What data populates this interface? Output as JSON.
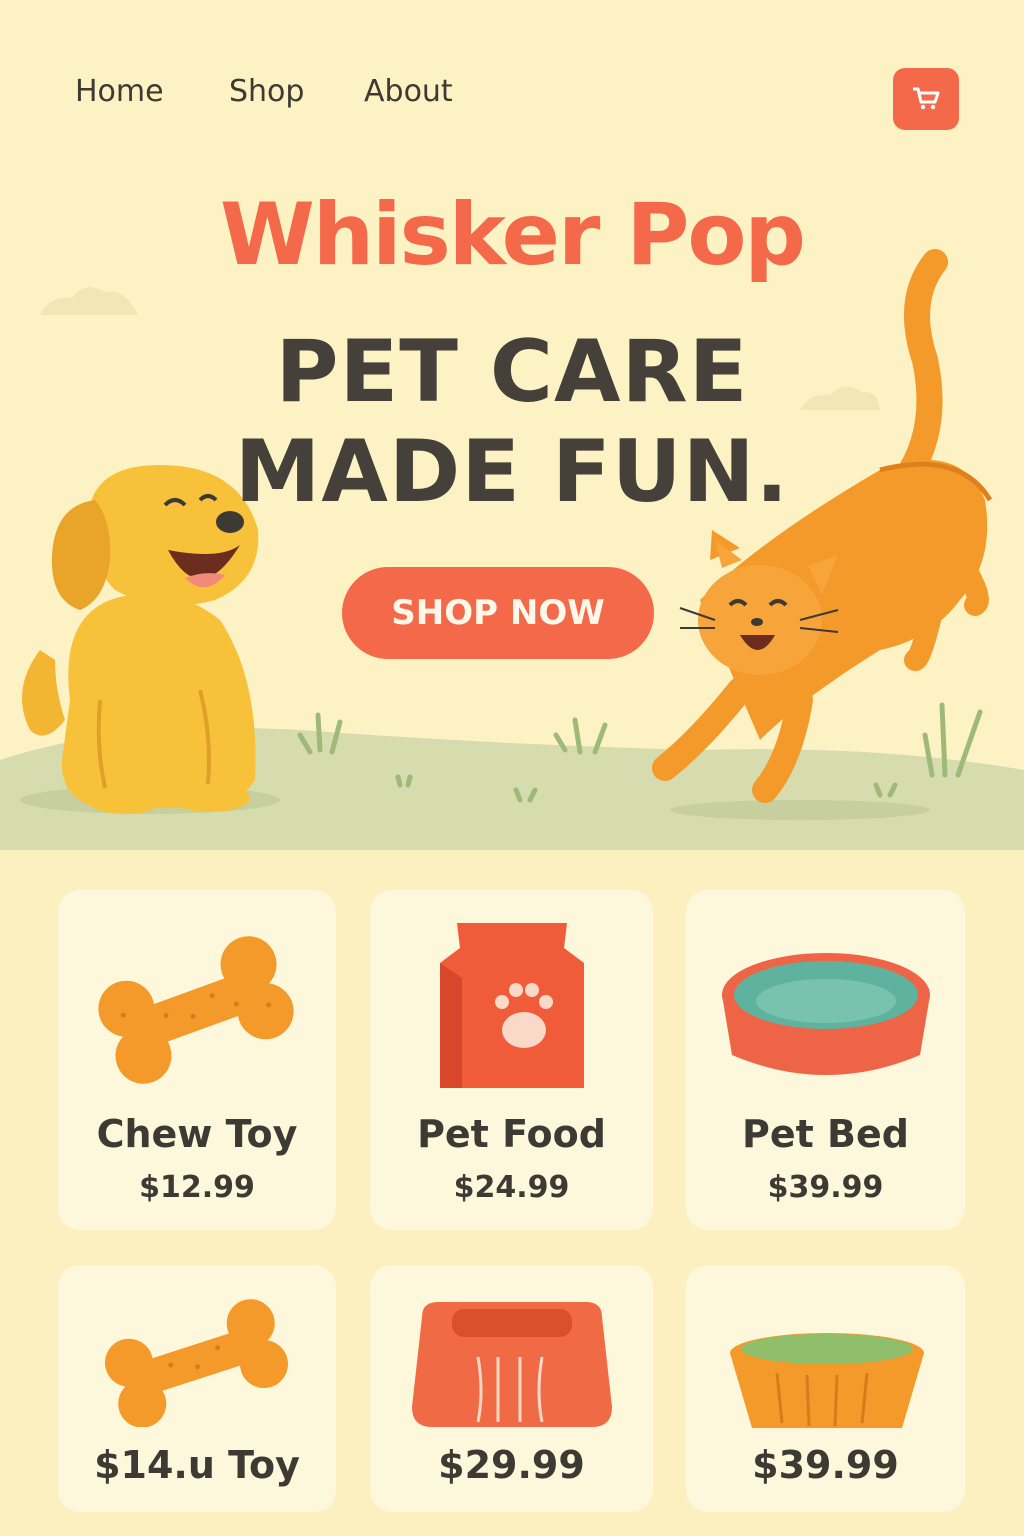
{
  "nav": {
    "items": [
      "Home",
      "Shop",
      "About"
    ],
    "cart_icon": "cart-icon"
  },
  "hero": {
    "brand": "Whisker Pop",
    "headline_line1": "PET CARE",
    "headline_line2": "MADE FUN.",
    "cta": "SHOP NOW"
  },
  "products": [
    {
      "name": "Chew Toy",
      "price": "$12.99",
      "icon": "bone-icon"
    },
    {
      "name": "Pet Food",
      "price": "$24.99",
      "icon": "food-bag-icon"
    },
    {
      "name": "Pet Bed",
      "price": "$39.99",
      "icon": "pet-bed-icon"
    },
    {
      "label": "$14.u Toy",
      "icon": "bone-icon"
    },
    {
      "label": "$29.99",
      "icon": "carrier-icon"
    },
    {
      "label": "$39.99",
      "icon": "bowl-icon"
    }
  ],
  "colors": {
    "accent": "#f4694a",
    "background": "#fcf0c0",
    "card": "#fdf7dc",
    "text": "#3d3a33",
    "grass": "#d4dca8"
  }
}
